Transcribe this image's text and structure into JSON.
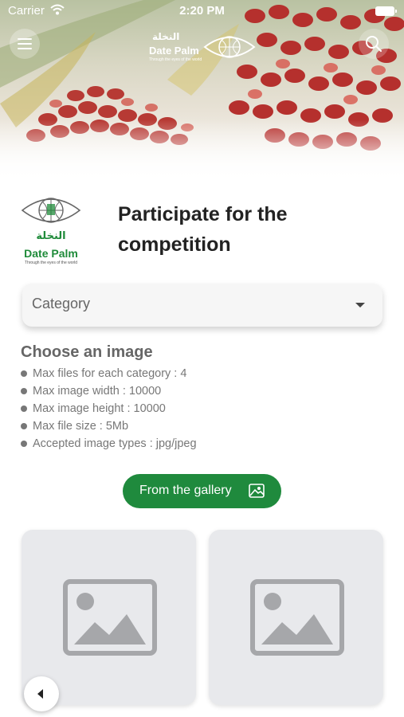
{
  "status_bar": {
    "carrier": "Carrier",
    "time": "2:20 PM"
  },
  "header": {
    "logo_arabic": "النخلة",
    "logo_english": "Date Palm",
    "logo_tagline": "Through the eyes of the world"
  },
  "brand": {
    "logo_arabic": "النخلة",
    "logo_english": "Date Palm",
    "logo_tagline": "Through the eyes of the world"
  },
  "page_title": "Participate for the competition",
  "category": {
    "placeholder": "Category"
  },
  "choose_image": {
    "title": "Choose an image",
    "rules": [
      "Max files for each category : 4",
      "Max image width : 10000",
      "Max image height : 10000",
      "Max file size : 5Mb",
      "Accepted image types : jpg/jpeg"
    ]
  },
  "gallery_button": {
    "label": "From the gallery"
  },
  "colors": {
    "brand_green": "#1f8a3d",
    "slot_bg": "#e8e9ec",
    "placeholder_icon": "#a6a7aa"
  }
}
